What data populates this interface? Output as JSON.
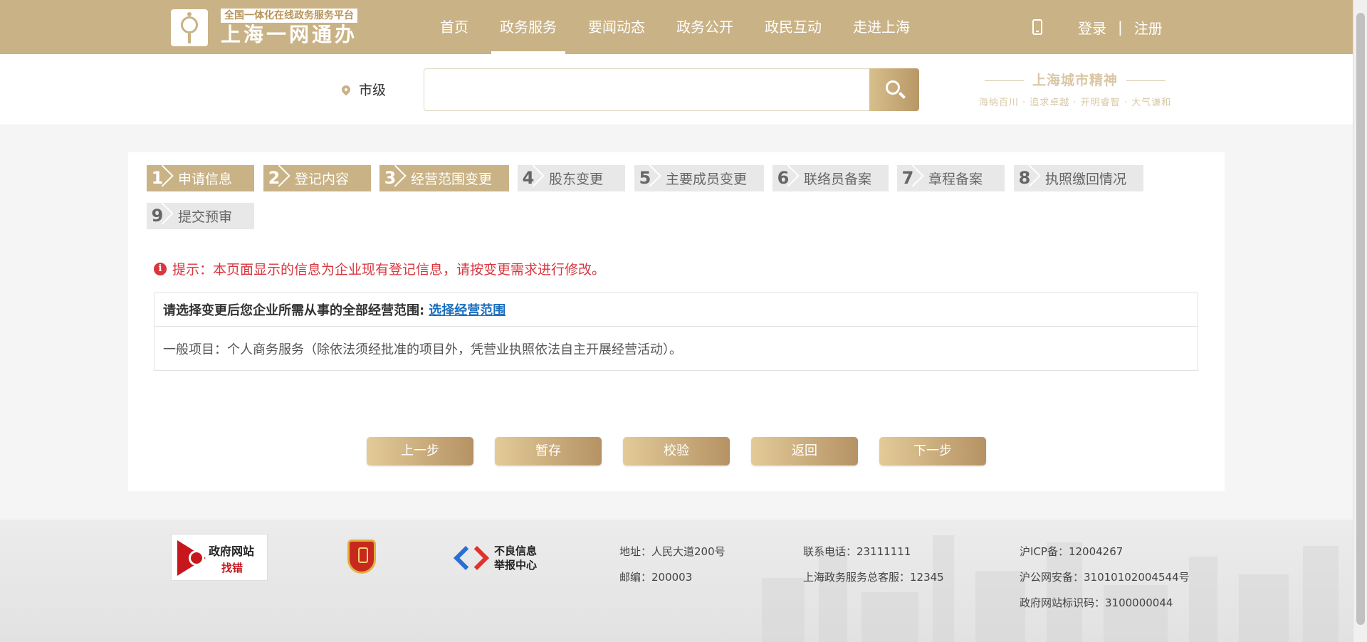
{
  "header": {
    "logo_sub": "全国一体化在线政务服务平台",
    "logo_main": "上海一网通办",
    "nav": [
      "首页",
      "政务服务",
      "要闻动态",
      "政务公开",
      "政民互动",
      "走进上海"
    ],
    "login": "登录",
    "separator": "|",
    "register": "注册"
  },
  "search": {
    "region": "市级",
    "placeholder": "",
    "slogan_title": "上海城市精神",
    "slogan_sub": "海纳百川 · 追求卓越 · 开明睿智 · 大气谦和"
  },
  "steps": [
    {
      "num": "1",
      "label": "申请信息",
      "status": "done"
    },
    {
      "num": "2",
      "label": "登记内容",
      "status": "done"
    },
    {
      "num": "3",
      "label": "经营范围变更",
      "status": "done"
    },
    {
      "num": "4",
      "label": "股东变更",
      "status": "todo"
    },
    {
      "num": "5",
      "label": "主要成员变更",
      "status": "todo"
    },
    {
      "num": "6",
      "label": "联络员备案",
      "status": "todo"
    },
    {
      "num": "7",
      "label": "章程备案",
      "status": "todo"
    },
    {
      "num": "8",
      "label": "执照缴回情况",
      "status": "todo"
    },
    {
      "num": "9",
      "label": "提交预审",
      "status": "todo"
    }
  ],
  "notice": "提示：本页面显示的信息为企业现有登记信息，请按变更需求进行修改。",
  "scope": {
    "prompt": "请选择变更后您企业所需从事的全部经营范围:",
    "link": "选择经营范围",
    "content": "一般项目：个人商务服务（除依法须经批准的项目外，凭营业执照依法自主开展经营活动）。"
  },
  "actions": [
    "上一步",
    "暂存",
    "校验",
    "返回",
    "下一步"
  ],
  "footer": {
    "gov_badge_line1": "政府网站",
    "gov_badge_line2": "找错",
    "report_line1": "不良信息",
    "report_line2": "举报中心",
    "address": "地址：人民大道200号",
    "postcode": "邮编：200003",
    "phone": "联系电话：23111111",
    "hotline": "上海政务服务总客服：12345",
    "icp": "沪ICP备：12004267",
    "police": "沪公网安备：31010102004544号",
    "site_code": "政府网站标识码：3100000044"
  },
  "colors": {
    "brand": "#c9b285",
    "alert": "#d9363e",
    "link": "#1b6ebd"
  }
}
